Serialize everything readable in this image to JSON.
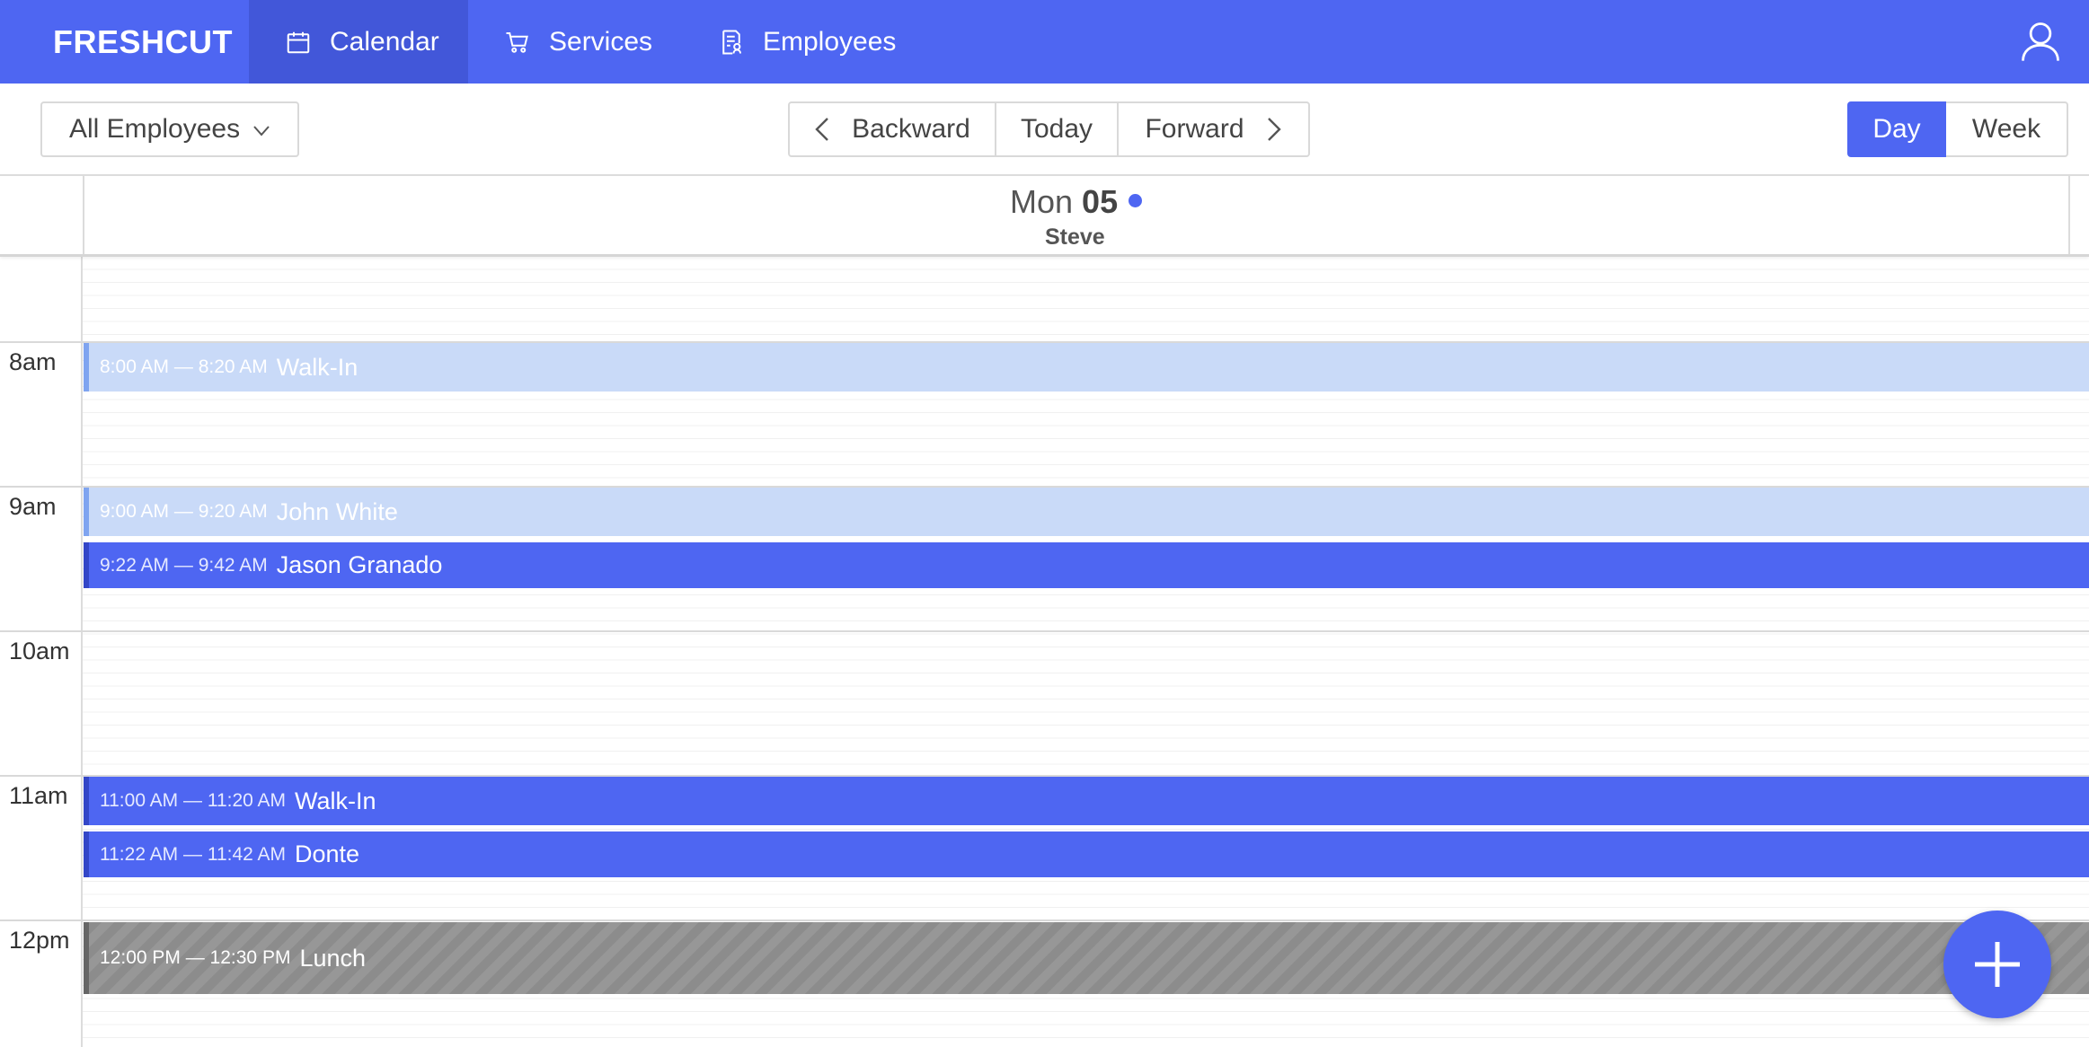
{
  "brand": "FRESHCUT",
  "nav": {
    "calendar": "Calendar",
    "services": "Services",
    "employees": "Employees"
  },
  "toolbar": {
    "employee_filter": "All Employees",
    "backward": "Backward",
    "today": "Today",
    "forward": "Forward",
    "view_day": "Day",
    "view_week": "Week",
    "active_view": "Day"
  },
  "calendar": {
    "day_name": "Mon",
    "day_number": "05",
    "employee": "Steve",
    "hours": [
      "8am",
      "9am",
      "10am",
      "11am",
      "12pm"
    ],
    "events": [
      {
        "time": "8:00 AM — 8:20 AM",
        "title": "Walk-In",
        "style": "light"
      },
      {
        "time": "9:00 AM — 9:20 AM",
        "title": "John White",
        "style": "light"
      },
      {
        "time": "9:22 AM — 9:42 AM",
        "title": "Jason Granado",
        "style": "blue"
      },
      {
        "time": "11:00 AM — 11:20 AM",
        "title": "Walk-In",
        "style": "blue"
      },
      {
        "time": "11:22 AM — 11:42 AM",
        "title": "Donte",
        "style": "blue"
      },
      {
        "time": "12:00 PM — 12:30 PM",
        "title": "Lunch",
        "style": "lunch"
      }
    ]
  },
  "colors": {
    "primary": "#4e66f2",
    "primary_dark": "#4257d9",
    "event_light": "#c9daf8",
    "lunch": "#8c8c8c"
  },
  "icons": {
    "calendar": "calendar-icon",
    "services": "cart-icon",
    "employees": "id-badge-icon",
    "user": "user-icon",
    "add": "plus-icon"
  }
}
